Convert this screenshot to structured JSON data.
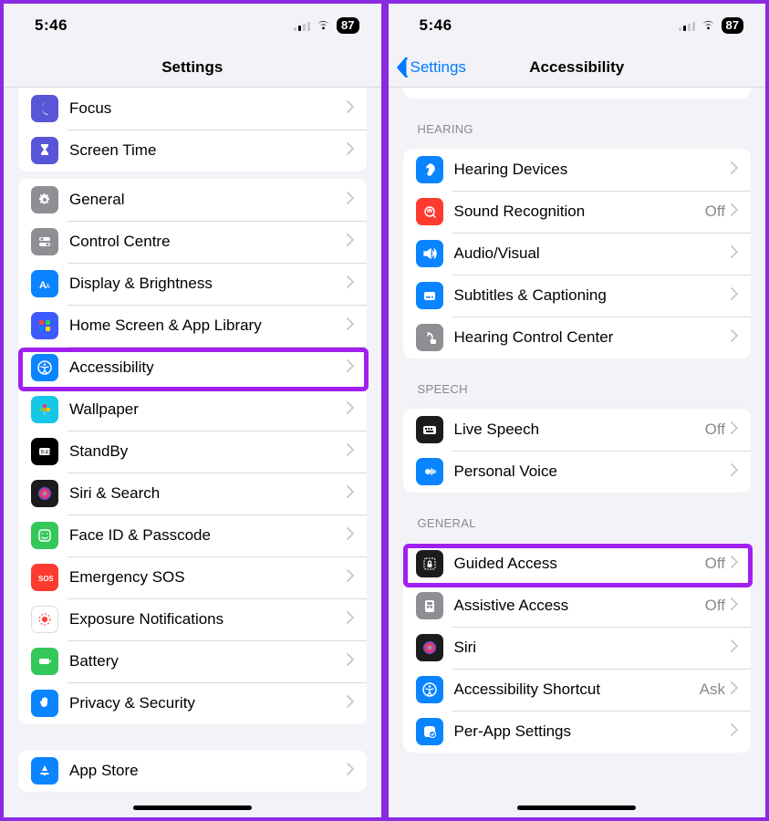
{
  "statusBar": {
    "time": "5:46",
    "battery": "87"
  },
  "left": {
    "title": "Settings",
    "group1": [
      {
        "label": "Focus",
        "iconBg": "#5856d6",
        "icon": "moon"
      },
      {
        "label": "Screen Time",
        "iconBg": "#5856d6",
        "icon": "hourglass"
      }
    ],
    "group2": [
      {
        "label": "General",
        "iconBg": "#8e8e93",
        "icon": "gear"
      },
      {
        "label": "Control Centre",
        "iconBg": "#8e8e93",
        "icon": "switches"
      },
      {
        "label": "Display & Brightness",
        "iconBg": "#0a84ff",
        "icon": "textsize"
      },
      {
        "label": "Home Screen & App Library",
        "iconBg": "#3d5afe",
        "icon": "apps"
      },
      {
        "label": "Accessibility",
        "iconBg": "#0a84ff",
        "icon": "accessibility",
        "hl": true
      },
      {
        "label": "Wallpaper",
        "iconBg": "#17c7e8",
        "icon": "flower"
      },
      {
        "label": "StandBy",
        "iconBg": "#000000",
        "icon": "clock"
      },
      {
        "label": "Siri & Search",
        "iconBg": "#1c1c1e",
        "icon": "siri"
      },
      {
        "label": "Face ID & Passcode",
        "iconBg": "#34c759",
        "icon": "faceid"
      },
      {
        "label": "Emergency SOS",
        "iconBg": "#ff3b30",
        "icon": "sos"
      },
      {
        "label": "Exposure Notifications",
        "iconBg": "#ffffff",
        "icon": "exposure"
      },
      {
        "label": "Battery",
        "iconBg": "#34c759",
        "icon": "battery"
      },
      {
        "label": "Privacy & Security",
        "iconBg": "#0a84ff",
        "icon": "hand"
      }
    ],
    "group3": [
      {
        "label": "App Store",
        "iconBg": "#0a84ff",
        "icon": "appstore"
      }
    ]
  },
  "right": {
    "backLabel": "Settings",
    "title": "Accessibility",
    "sections": [
      {
        "header": "HEARING",
        "rows": [
          {
            "label": "Hearing Devices",
            "iconBg": "#0a84ff",
            "icon": "ear"
          },
          {
            "label": "Sound Recognition",
            "iconBg": "#ff3b30",
            "icon": "soundrec",
            "detail": "Off"
          },
          {
            "label": "Audio/Visual",
            "iconBg": "#0a84ff",
            "icon": "speaker"
          },
          {
            "label": "Subtitles & Captioning",
            "iconBg": "#0a84ff",
            "icon": "subtitle"
          },
          {
            "label": "Hearing Control Center",
            "iconBg": "#8e8e93",
            "icon": "earctl"
          }
        ]
      },
      {
        "header": "SPEECH",
        "rows": [
          {
            "label": "Live Speech",
            "iconBg": "#1c1c1e",
            "icon": "keyboard",
            "detail": "Off"
          },
          {
            "label": "Personal Voice",
            "iconBg": "#0a84ff",
            "icon": "voice"
          }
        ]
      },
      {
        "header": "GENERAL",
        "rows": [
          {
            "label": "Guided Access",
            "iconBg": "#1c1c1e",
            "icon": "lock",
            "detail": "Off",
            "hl": true
          },
          {
            "label": "Assistive Access",
            "iconBg": "#8e8e93",
            "icon": "assist",
            "detail": "Off"
          },
          {
            "label": "Siri",
            "iconBg": "#1c1c1e",
            "icon": "siri"
          },
          {
            "label": "Accessibility Shortcut",
            "iconBg": "#0a84ff",
            "icon": "accessibility",
            "detail": "Ask"
          },
          {
            "label": "Per-App Settings",
            "iconBg": "#0a84ff",
            "icon": "perapp"
          }
        ]
      }
    ]
  }
}
